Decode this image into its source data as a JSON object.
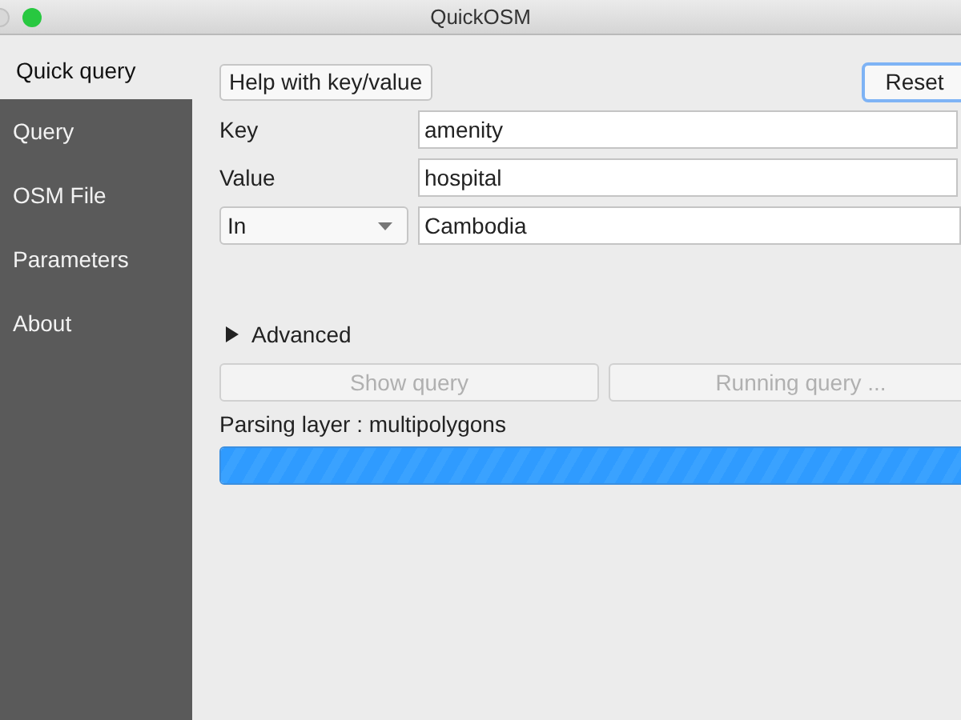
{
  "window": {
    "title": "QuickOSM"
  },
  "sidebar": {
    "items": [
      {
        "label": "Quick query",
        "selected": true
      },
      {
        "label": "Query",
        "selected": false
      },
      {
        "label": "OSM File",
        "selected": false
      },
      {
        "label": "Parameters",
        "selected": false
      },
      {
        "label": "About",
        "selected": false
      }
    ]
  },
  "help_button": "Help with key/value",
  "reset_button": {
    "label": "Reset",
    "focused": true
  },
  "fields": [
    {
      "label": "Key",
      "value": "amenity"
    },
    {
      "label": "Value",
      "value": "hospital"
    }
  ],
  "area": {
    "mode": "In",
    "value": "Cambodia"
  },
  "advanced": {
    "label": "Advanced",
    "expanded": false
  },
  "actions": [
    {
      "label": "Show query",
      "disabled": true
    },
    {
      "label": "Running query ...",
      "disabled": true
    }
  ],
  "status": "Parsing layer : multipolygons",
  "progress": {
    "level": 1
  }
}
